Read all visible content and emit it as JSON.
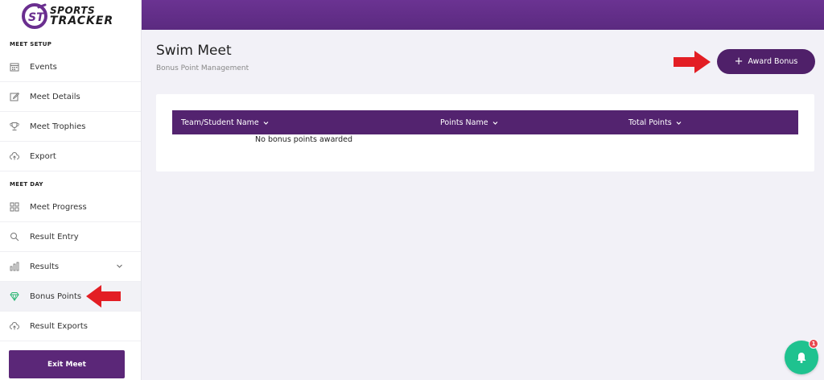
{
  "brand": {
    "line1": "SPORTS",
    "line2": "TRACKER",
    "logo_color": "#6a2e8f"
  },
  "sidebar": {
    "meet_setup_label": "MEET SETUP",
    "meet_day_label": "MEET DAY",
    "setup_items": [
      {
        "label": "Events",
        "icon": "calendar-icon"
      },
      {
        "label": "Meet Details",
        "icon": "edit-icon"
      },
      {
        "label": "Meet Trophies",
        "icon": "trophy-icon"
      },
      {
        "label": "Export",
        "icon": "cloud-upload-icon"
      }
    ],
    "day_items": [
      {
        "label": "Meet Progress",
        "icon": "grid-icon"
      },
      {
        "label": "Result Entry",
        "icon": "search-icon"
      },
      {
        "label": "Results",
        "icon": "bar-chart-icon"
      },
      {
        "label": "Bonus Points",
        "icon": "gem-icon",
        "active": true
      },
      {
        "label": "Result Exports",
        "icon": "cloud-upload-icon"
      }
    ],
    "exit_label": "Exit Meet"
  },
  "header": {
    "title": "Swim Meet",
    "subtitle": "Bonus Point Management",
    "award_button_label": "Award Bonus"
  },
  "table": {
    "columns": [
      "Team/Student Name",
      "Points Name",
      "Total Points"
    ],
    "empty_message": "No bonus points awarded"
  },
  "notifications": {
    "count": "1"
  },
  "colors": {
    "primary": "#53236f",
    "topbar": "#5f2d85",
    "notification": "#1fc28f",
    "badge": "#e8474f",
    "arrow": "#e31e24",
    "active_icon": "#2bb673"
  }
}
